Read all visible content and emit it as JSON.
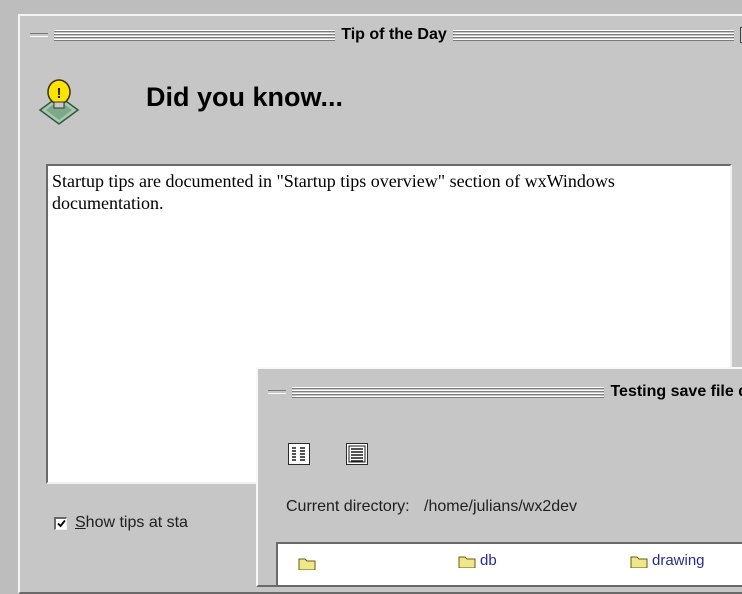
{
  "tip_window": {
    "title": "Tip of the Day",
    "heading": "Did you know...",
    "tip_text": "Startup tips are documented in \"Startup tips overview\" section of wxWindows documentation.",
    "checkbox_label_underlined": "S",
    "checkbox_label_rest": "how tips at sta",
    "checkbox_checked": true,
    "icon": "lightbulb-icon"
  },
  "file_window": {
    "title": "Testing save file d",
    "current_directory_label": "Current directory:",
    "current_directory_value": "/home/julians/wx2dev",
    "toolbar_icons": [
      "list-view-icon",
      "detail-view-icon"
    ],
    "files": [
      "",
      "db",
      "drawing"
    ]
  },
  "colors": {
    "window_bg": "#c6c6c6",
    "tip_text_bg": "#ffffff",
    "bulb_yellow": "#ffe400",
    "folder_yellow": "#f0e68c",
    "file_link": "#2a2a8a"
  }
}
